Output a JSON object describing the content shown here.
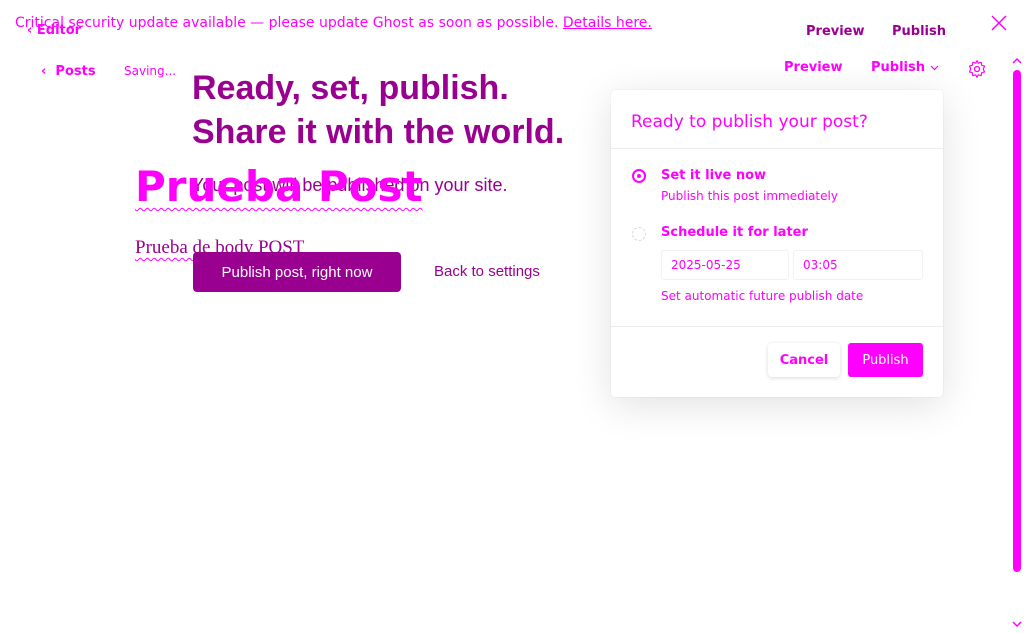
{
  "banner": {
    "text": "Critical security update available — please update Ghost as soon as possible.",
    "link": "Details here."
  },
  "nav": {
    "editor_label": "Editor",
    "posts_label": "Posts",
    "status": "Saving..."
  },
  "top_bar": {
    "preview": "Preview",
    "publish": "Publish"
  },
  "header": {
    "preview": "Preview",
    "publish": "Publish"
  },
  "hero": {
    "line1": "Ready, set, publish.",
    "line2": "Share it with the world.",
    "subtitle": "Your post will be published on your site.",
    "publish_now": "Publish post, right now",
    "back_to_settings": "Back to settings"
  },
  "post": {
    "title": "Prueba Post",
    "body": "Prueba de body POST"
  },
  "popover": {
    "title": "Ready to publish your post?",
    "options": [
      {
        "label": "Set it live now",
        "desc": "Publish this post immediately",
        "selected": true
      },
      {
        "label": "Schedule it for later",
        "desc": "Set automatic future publish date",
        "selected": false
      }
    ],
    "date": "2025-05-25",
    "time": "03:05",
    "cancel": "Cancel",
    "confirm": "Publish"
  },
  "colors": {
    "accent": "#ff00ff",
    "dark_accent": "#99008f"
  },
  "icons": [
    "chevron-left-icon",
    "close-icon",
    "gear-icon",
    "chevron-down-icon"
  ]
}
